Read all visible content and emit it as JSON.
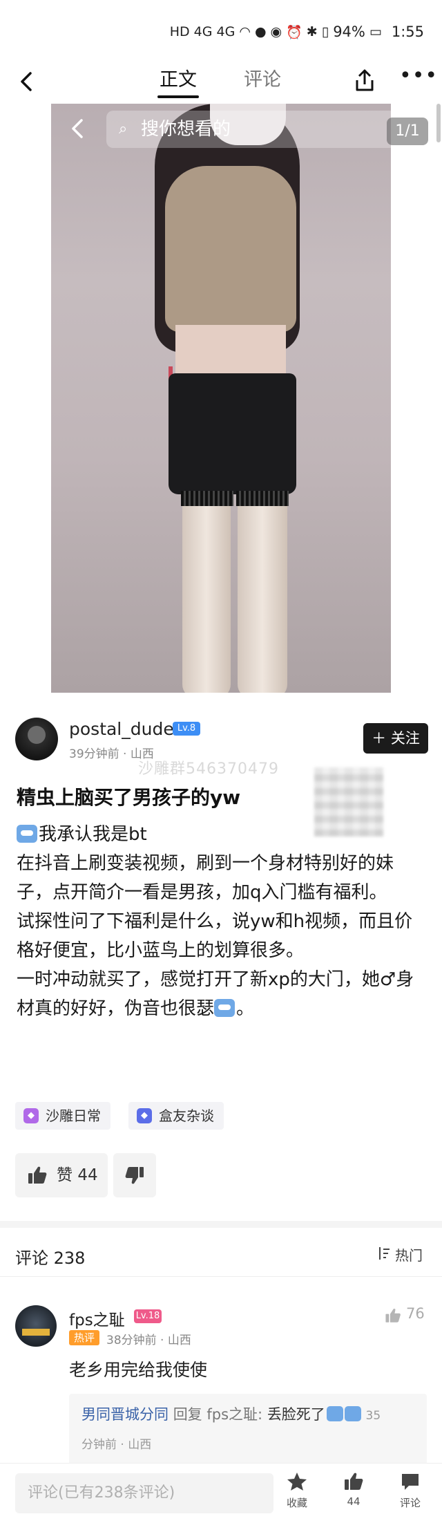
{
  "status_bar": {
    "network_labels": "HD 4G 4G",
    "battery": "94%",
    "time": "1:55"
  },
  "nav": {
    "tab_main": "正文",
    "tab_comments": "评论"
  },
  "hero": {
    "search_placeholder": "搜你想看的",
    "page_indicator": "1/1"
  },
  "author": {
    "name": "postal_dude",
    "level": "Lv.8",
    "meta": "39分钟前 · 山西",
    "follow_label": "关注"
  },
  "watermark": "沙雕群546370479",
  "post": {
    "title": "精虫上脑买了男孩子的yw",
    "line1": "我承认我是bt",
    "para1": "在抖音上刷变装视频，刷到一个身材特别好的妹子，点开简介一看是男孩，加q入门槛有福利。",
    "para2": "试探性问了下福利是什么，说yw和h视频，而且价格好便宜，比小蓝鸟上的划算很多。",
    "para3a": "一时冲动就买了，感觉打开了新xp的大门，她♂身材真的好好，伪音也很瑟",
    "para3b": "。"
  },
  "tags": [
    {
      "label": "沙雕日常",
      "color": "#b069e8"
    },
    {
      "label": "盒友杂谈",
      "color": "#5b6de8"
    }
  ],
  "actions": {
    "like_label": "赞",
    "like_count": "44"
  },
  "comments": {
    "header": "评论 238",
    "sort_label": "热门",
    "items": [
      {
        "user": "fps之耻",
        "level": "Lv.18",
        "badge": "热评",
        "meta": "38分钟前 · 山西",
        "likes": "76",
        "text": "老乡用完给我使使",
        "reply": {
          "user": "男同晋城分同",
          "verb": "回复",
          "target": "fps之耻:",
          "text": "丢脸死了",
          "time_a": "35",
          "time_b": "分钟前 · 山西"
        }
      }
    ]
  },
  "bottom_bar": {
    "input_placeholder": "评论(已有238条评论)",
    "fav_label": "收藏",
    "like_count": "44",
    "comment_label": "评论"
  }
}
